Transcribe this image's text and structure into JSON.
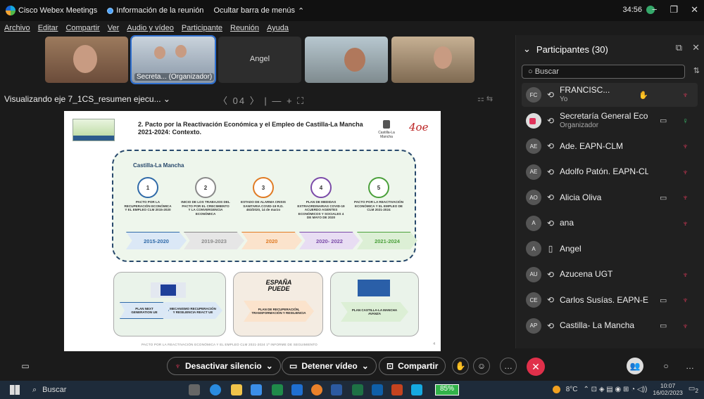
{
  "app": {
    "title": "Cisco Webex Meetings",
    "info": "Información de la reunión",
    "hide_menu": "Ocultar barra de menús",
    "timer": "34:56"
  },
  "menu": [
    "Archivo",
    "Editar",
    "Compartir",
    "Ver",
    "Audio y vídeo",
    "Participante",
    "Reunión",
    "Ayuda"
  ],
  "videos": {
    "v2_label": "Secreta... (Organizador)",
    "v3_label": "Angel"
  },
  "viewing": {
    "label": "Visualizando eje 7_1CS_resumen ejecu...",
    "page": "04",
    "zoom_out": "—",
    "zoom_in": "+"
  },
  "slide": {
    "title": "2. Pacto por la Reactivación Económica y el Empleo de Castilla-La Mancha 2021-2024: Contexto.",
    "region": "Castilla-La Mancha",
    "clm_logo": "Castilla-La Mancha",
    "eapn_logo": "4oe",
    "steps": [
      {
        "n": "1",
        "text": "PACTO POR LA RECUPERACIÓN ECONÓMICA Y EL EMPLEO CLM 2015-2020",
        "period": "2015-2020",
        "color": "#2f6aa8",
        "fill": "#dbe8f6"
      },
      {
        "n": "2",
        "text": "INICIO DE LOS TRABAJOS DEL PACTO POR EL CRECIMIENTO Y LA CONVERGENCIA ECONÓMICA",
        "period": "2019-2023",
        "color": "#8a8a8a",
        "fill": "#e6e6e6"
      },
      {
        "n": "3",
        "text": "ESTADO DE ALARMA CRISIS SANITARIA COVID-19 R.D. 463/2020, 14 de marzo",
        "period": "2020",
        "color": "#e07b24",
        "fill": "#fbe3cc"
      },
      {
        "n": "4",
        "text": "PLAN DE MEDIDAS EXTRAORDINARIAS COVID-19 ACUERDO AGENTES ECONÓMICOS Y SOCIALES 4 DE MAYO DE 2020",
        "period": "2020- 2022",
        "color": "#7a4aa8",
        "fill": "#e8ddf3"
      },
      {
        "n": "5",
        "text": "PACTO POR LA REACTIVACIÓN ECONÓMICA Y EL EMPLEO DE CLM 2021-2024",
        "period": "2021-2024",
        "color": "#4aa03a",
        "fill": "#dcefd5"
      }
    ],
    "eu": {
      "a": "PLAN NEXT GENERATION UE",
      "b": "MECANISMO RECUPERACIÓN Y RESILIENCIA REACT UE"
    },
    "spain": {
      "logo": "ESPAÑA PUEDE",
      "plan": "PLAN DE RECUPERACIÓN, TRANSFORMACIÓN Y RESILIENCIA"
    },
    "clm": {
      "plan": "PLAN CASTILLA-LA MANCHA AVANZA"
    },
    "footer": "PACTO POR LA REACTIVACIÓN ECONÓMICA Y EL EMPLEO CLM 2021-2024 1ª INFORME DE SEGUIMIENTO",
    "page_num": "4"
  },
  "participants": {
    "title": "Participantes (30)",
    "search_placeholder": "Buscar",
    "list": [
      {
        "initials": "FC",
        "name": "FRANCISC...",
        "sub": "Yo",
        "video": false,
        "mic": "muted"
      },
      {
        "initials": "",
        "name": "Secretaría General Eco...",
        "sub": "Organizador",
        "video": true,
        "mic": "on"
      },
      {
        "initials": "AE",
        "name": "Ade. EAPN-CLM",
        "sub": "",
        "video": false,
        "mic": "muted"
      },
      {
        "initials": "AE",
        "name": "Adolfo Patón. EAPN-CLM",
        "sub": "",
        "video": false,
        "mic": "muted"
      },
      {
        "initials": "AO",
        "name": "Alicia Oliva",
        "sub": "",
        "video": true,
        "mic": "muted"
      },
      {
        "initials": "A",
        "name": "ana",
        "sub": "",
        "video": false,
        "mic": "muted"
      },
      {
        "initials": "A",
        "name": "Angel",
        "sub": "",
        "video": false,
        "mic": "none"
      },
      {
        "initials": "AU",
        "name": "Azucena UGT",
        "sub": "",
        "video": false,
        "mic": "muted"
      },
      {
        "initials": "CE",
        "name": "Carlos Susías. EAPN-ES",
        "sub": "",
        "video": true,
        "mic": "muted"
      },
      {
        "initials": "AP",
        "name": "Castilla- La Mancha",
        "sub": "",
        "video": true,
        "mic": "muted"
      }
    ]
  },
  "controls": {
    "mute": "Desactivar silencio",
    "video": "Detener vídeo",
    "share": "Compartir"
  },
  "taskbar": {
    "search": "Buscar",
    "battery": "85%",
    "weather": "8°C",
    "time": "10:07",
    "date": "16/02/2023",
    "notif": "2"
  }
}
